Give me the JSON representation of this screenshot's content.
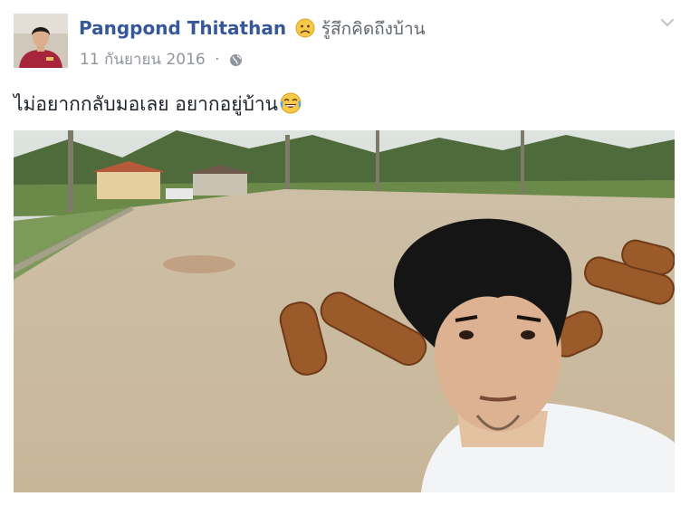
{
  "post": {
    "author": "Pangpond Thitathan",
    "feeling": "รู้สึกคิดถึงบ้าน",
    "feeling_icon": "sad-face-emoji",
    "date": "11 กันยายน 2016",
    "separator": "·",
    "audience_icon": "globe-icon",
    "menu_icon": "chevron-down-icon",
    "message": "ไม่อยากกลับมอเลย อยากอยู่บ้าน",
    "message_emoji": "laughing-tears-emoji"
  },
  "colors": {
    "author": "#365899",
    "meta": "#90949c",
    "text": "#1d2129"
  }
}
